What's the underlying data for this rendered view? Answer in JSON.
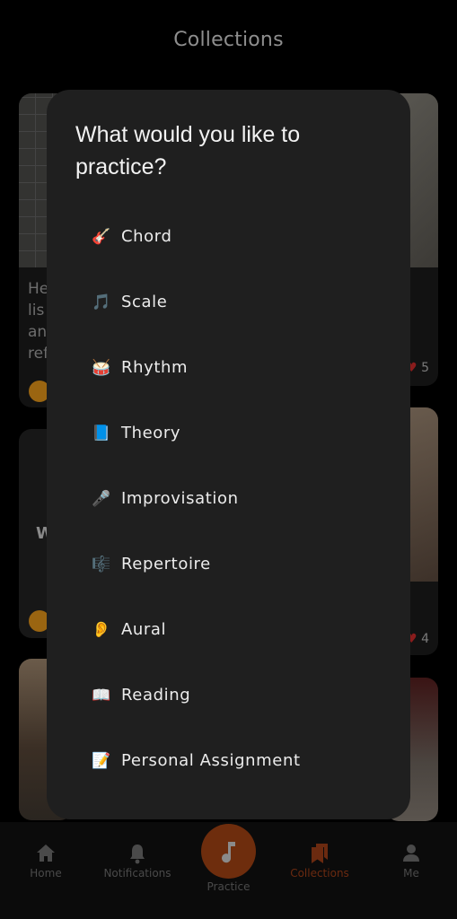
{
  "header": {
    "title": "Collections"
  },
  "background": {
    "card1_text": "He\nlis\nan\nref",
    "card2_text": "W",
    "card4_likes": "5",
    "card5_likes": "4"
  },
  "modal": {
    "title": "What would you like to practice?",
    "options": [
      {
        "emoji": "🎸",
        "label": "Chord",
        "icon": "guitar-icon"
      },
      {
        "emoji": "🎵",
        "label": "Scale",
        "icon": "music-note-icon"
      },
      {
        "emoji": "🥁",
        "label": "Rhythm",
        "icon": "drum-icon"
      },
      {
        "emoji": "📘",
        "label": "Theory",
        "icon": "blue-book-icon"
      },
      {
        "emoji": "🎤",
        "label": "Improvisation",
        "icon": "microphone-icon"
      },
      {
        "emoji": "🎼",
        "label": "Repertoire",
        "icon": "musical-score-icon"
      },
      {
        "emoji": "👂",
        "label": "Aural",
        "icon": "ear-icon"
      },
      {
        "emoji": "📖",
        "label": "Reading",
        "icon": "open-book-icon"
      },
      {
        "emoji": "📝",
        "label": "Personal Assignment",
        "icon": "memo-icon"
      }
    ]
  },
  "tabbar": {
    "home": "Home",
    "notifications": "Notifications",
    "practice": "Practice",
    "collections": "Collections",
    "me": "Me",
    "active_tab": "collections",
    "accent_color": "#6e2d0d"
  }
}
